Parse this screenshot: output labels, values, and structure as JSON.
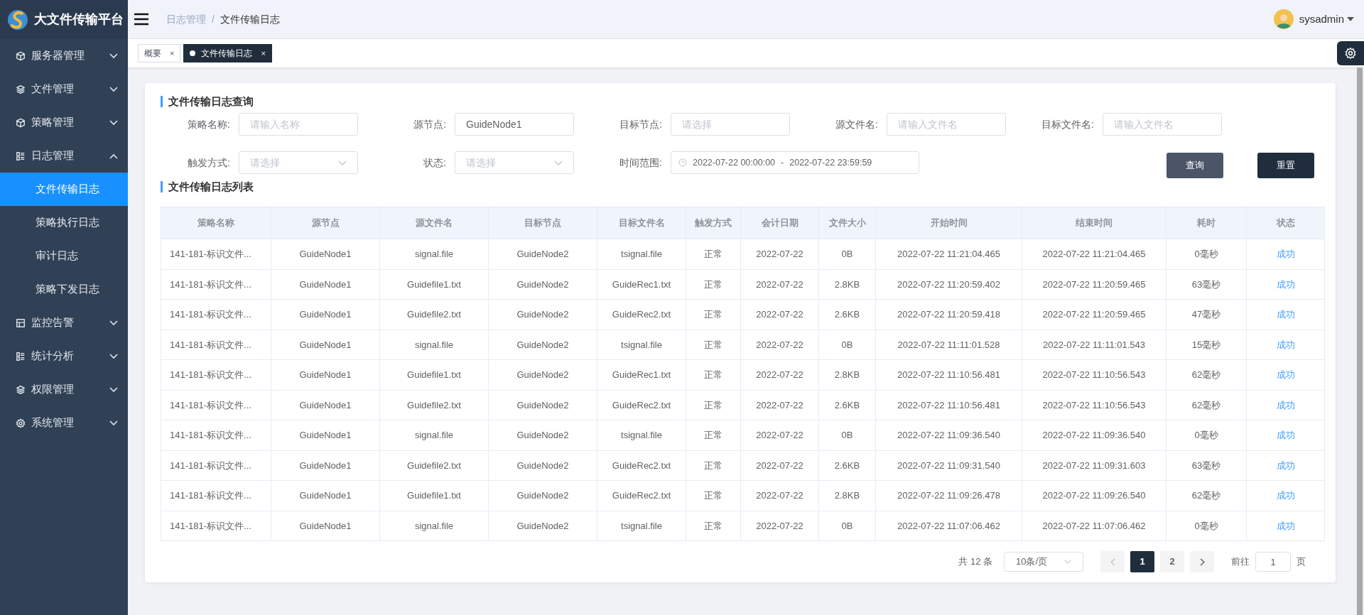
{
  "app": {
    "title": "大文件传输平台"
  },
  "sidebar": {
    "items": [
      {
        "label": "服务器管理",
        "expanded": false
      },
      {
        "label": "文件管理",
        "expanded": false
      },
      {
        "label": "策略管理",
        "expanded": false
      },
      {
        "label": "日志管理",
        "expanded": true,
        "children": [
          {
            "label": "文件传输日志",
            "selected": true
          },
          {
            "label": "策略执行日志",
            "selected": false
          },
          {
            "label": "审计日志",
            "selected": false
          },
          {
            "label": "策略下发日志",
            "selected": false
          }
        ]
      },
      {
        "label": "监控告警",
        "expanded": false
      },
      {
        "label": "统计分析",
        "expanded": false
      },
      {
        "label": "权限管理",
        "expanded": false
      },
      {
        "label": "系统管理",
        "expanded": false
      }
    ]
  },
  "breadcrumb": {
    "items": [
      "日志管理",
      "文件传输日志"
    ],
    "separator": "/"
  },
  "user": {
    "name": "sysadmin"
  },
  "tabs": [
    {
      "label": "概要",
      "selected": false,
      "close": "×"
    },
    {
      "label": "文件传输日志",
      "selected": true,
      "close": "×"
    }
  ],
  "query": {
    "title": "文件传输日志查询",
    "fields": [
      {
        "label": "策略名称:",
        "kind": "input",
        "placeholder": "请输入名称"
      },
      {
        "label": "源节点:",
        "kind": "input",
        "value": "GuideNode1"
      },
      {
        "label": "目标节点:",
        "kind": "input",
        "placeholder": "请选择"
      },
      {
        "label": "源文件名:",
        "kind": "input",
        "placeholder": "请输入文件名"
      },
      {
        "label": "目标文件名:",
        "kind": "input",
        "placeholder": "请输入文件名"
      },
      {
        "label": "触发方式:",
        "kind": "select",
        "placeholder": "请选择"
      },
      {
        "label": "状态:",
        "kind": "select",
        "placeholder": "请选择"
      },
      {
        "label": "时间范围:",
        "kind": "daterange",
        "start": "2022-07-22 00:00:00",
        "separator": "-",
        "end": "2022-07-22 23:59:59"
      }
    ],
    "buttons": [
      {
        "label": "查询",
        "kind": "secondary"
      },
      {
        "label": "重置",
        "kind": "primary"
      }
    ]
  },
  "table": {
    "title": "文件传输日志列表",
    "columns": [
      "策略名称",
      "源节点",
      "源文件名",
      "目标节点",
      "目标文件名",
      "触发方式",
      "会计日期",
      "文件大小",
      "开始时间",
      "结束时间",
      "耗时",
      "状态"
    ],
    "rows": [
      [
        "141-181-标识文件...",
        "GuideNode1",
        "signal.file",
        "GuideNode2",
        "tsignal.file",
        "正常",
        "2022-07-22",
        "0B",
        "2022-07-22 11:21:04.465",
        "2022-07-22 11:21:04.465",
        "0毫秒",
        "成功"
      ],
      [
        "141-181-标识文件...",
        "GuideNode1",
        "Guidefile1.txt",
        "GuideNode2",
        "GuideRec1.txt",
        "正常",
        "2022-07-22",
        "2.8KB",
        "2022-07-22 11:20:59.402",
        "2022-07-22 11:20:59.465",
        "63毫秒",
        "成功"
      ],
      [
        "141-181-标识文件...",
        "GuideNode1",
        "Guidefile2.txt",
        "GuideNode2",
        "GuideRec2.txt",
        "正常",
        "2022-07-22",
        "2.6KB",
        "2022-07-22 11:20:59.418",
        "2022-07-22 11:20:59.465",
        "47毫秒",
        "成功"
      ],
      [
        "141-181-标识文件...",
        "GuideNode1",
        "signal.file",
        "GuideNode2",
        "tsignal.file",
        "正常",
        "2022-07-22",
        "0B",
        "2022-07-22 11:11:01.528",
        "2022-07-22 11:11:01.543",
        "15毫秒",
        "成功"
      ],
      [
        "141-181-标识文件...",
        "GuideNode1",
        "Guidefile1.txt",
        "GuideNode2",
        "GuideRec1.txt",
        "正常",
        "2022-07-22",
        "2.8KB",
        "2022-07-22 11:10:56.481",
        "2022-07-22 11:10:56.543",
        "62毫秒",
        "成功"
      ],
      [
        "141-181-标识文件...",
        "GuideNode1",
        "Guidefile2.txt",
        "GuideNode2",
        "GuideRec2.txt",
        "正常",
        "2022-07-22",
        "2.6KB",
        "2022-07-22 11:10:56.481",
        "2022-07-22 11:10:56.543",
        "62毫秒",
        "成功"
      ],
      [
        "141-181-标识文件...",
        "GuideNode1",
        "signal.file",
        "GuideNode2",
        "tsignal.file",
        "正常",
        "2022-07-22",
        "0B",
        "2022-07-22 11:09:36.540",
        "2022-07-22 11:09:36.540",
        "0毫秒",
        "成功"
      ],
      [
        "141-181-标识文件...",
        "GuideNode1",
        "Guidefile2.txt",
        "GuideNode2",
        "GuideRec2.txt",
        "正常",
        "2022-07-22",
        "2.6KB",
        "2022-07-22 11:09:31.540",
        "2022-07-22 11:09:31.603",
        "63毫秒",
        "成功"
      ],
      [
        "141-181-标识文件...",
        "GuideNode1",
        "Guidefile1.txt",
        "GuideNode2",
        "GuideRec2.txt",
        "正常",
        "2022-07-22",
        "2.8KB",
        "2022-07-22 11:09:26.478",
        "2022-07-22 11:09:26.540",
        "62毫秒",
        "成功"
      ],
      [
        "141-181-标识文件...",
        "GuideNode1",
        "signal.file",
        "GuideNode2",
        "tsignal.file",
        "正常",
        "2022-07-22",
        "0B",
        "2022-07-22 11:07:06.462",
        "2022-07-22 11:07:06.462",
        "0毫秒",
        "成功"
      ]
    ]
  },
  "pagination": {
    "total": "共 12 条",
    "page_size": "10条/页",
    "pages": [
      {
        "label": "1",
        "selected": true
      },
      {
        "label": "2",
        "selected": false
      }
    ],
    "goto_label": "前往",
    "goto_value": "1",
    "goto_suffix": "页"
  }
}
